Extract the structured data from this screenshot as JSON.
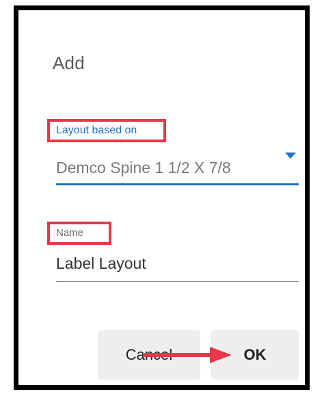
{
  "dialog": {
    "title": "Add"
  },
  "fields": {
    "layout_based_on": {
      "label": "Layout based on",
      "value": "Demco Spine 1 1/2 X 7/8"
    },
    "name": {
      "label": "Name",
      "value": "Label Layout"
    }
  },
  "buttons": {
    "cancel": "Cancel",
    "ok": "OK"
  },
  "colors": {
    "accent": "#1a73c8",
    "highlight": "#e8374a",
    "arrow": "#e8374a",
    "frame": "#000000"
  },
  "icons": {
    "dropdown": "caret-down-icon",
    "annotation": "arrow-right-icon"
  }
}
